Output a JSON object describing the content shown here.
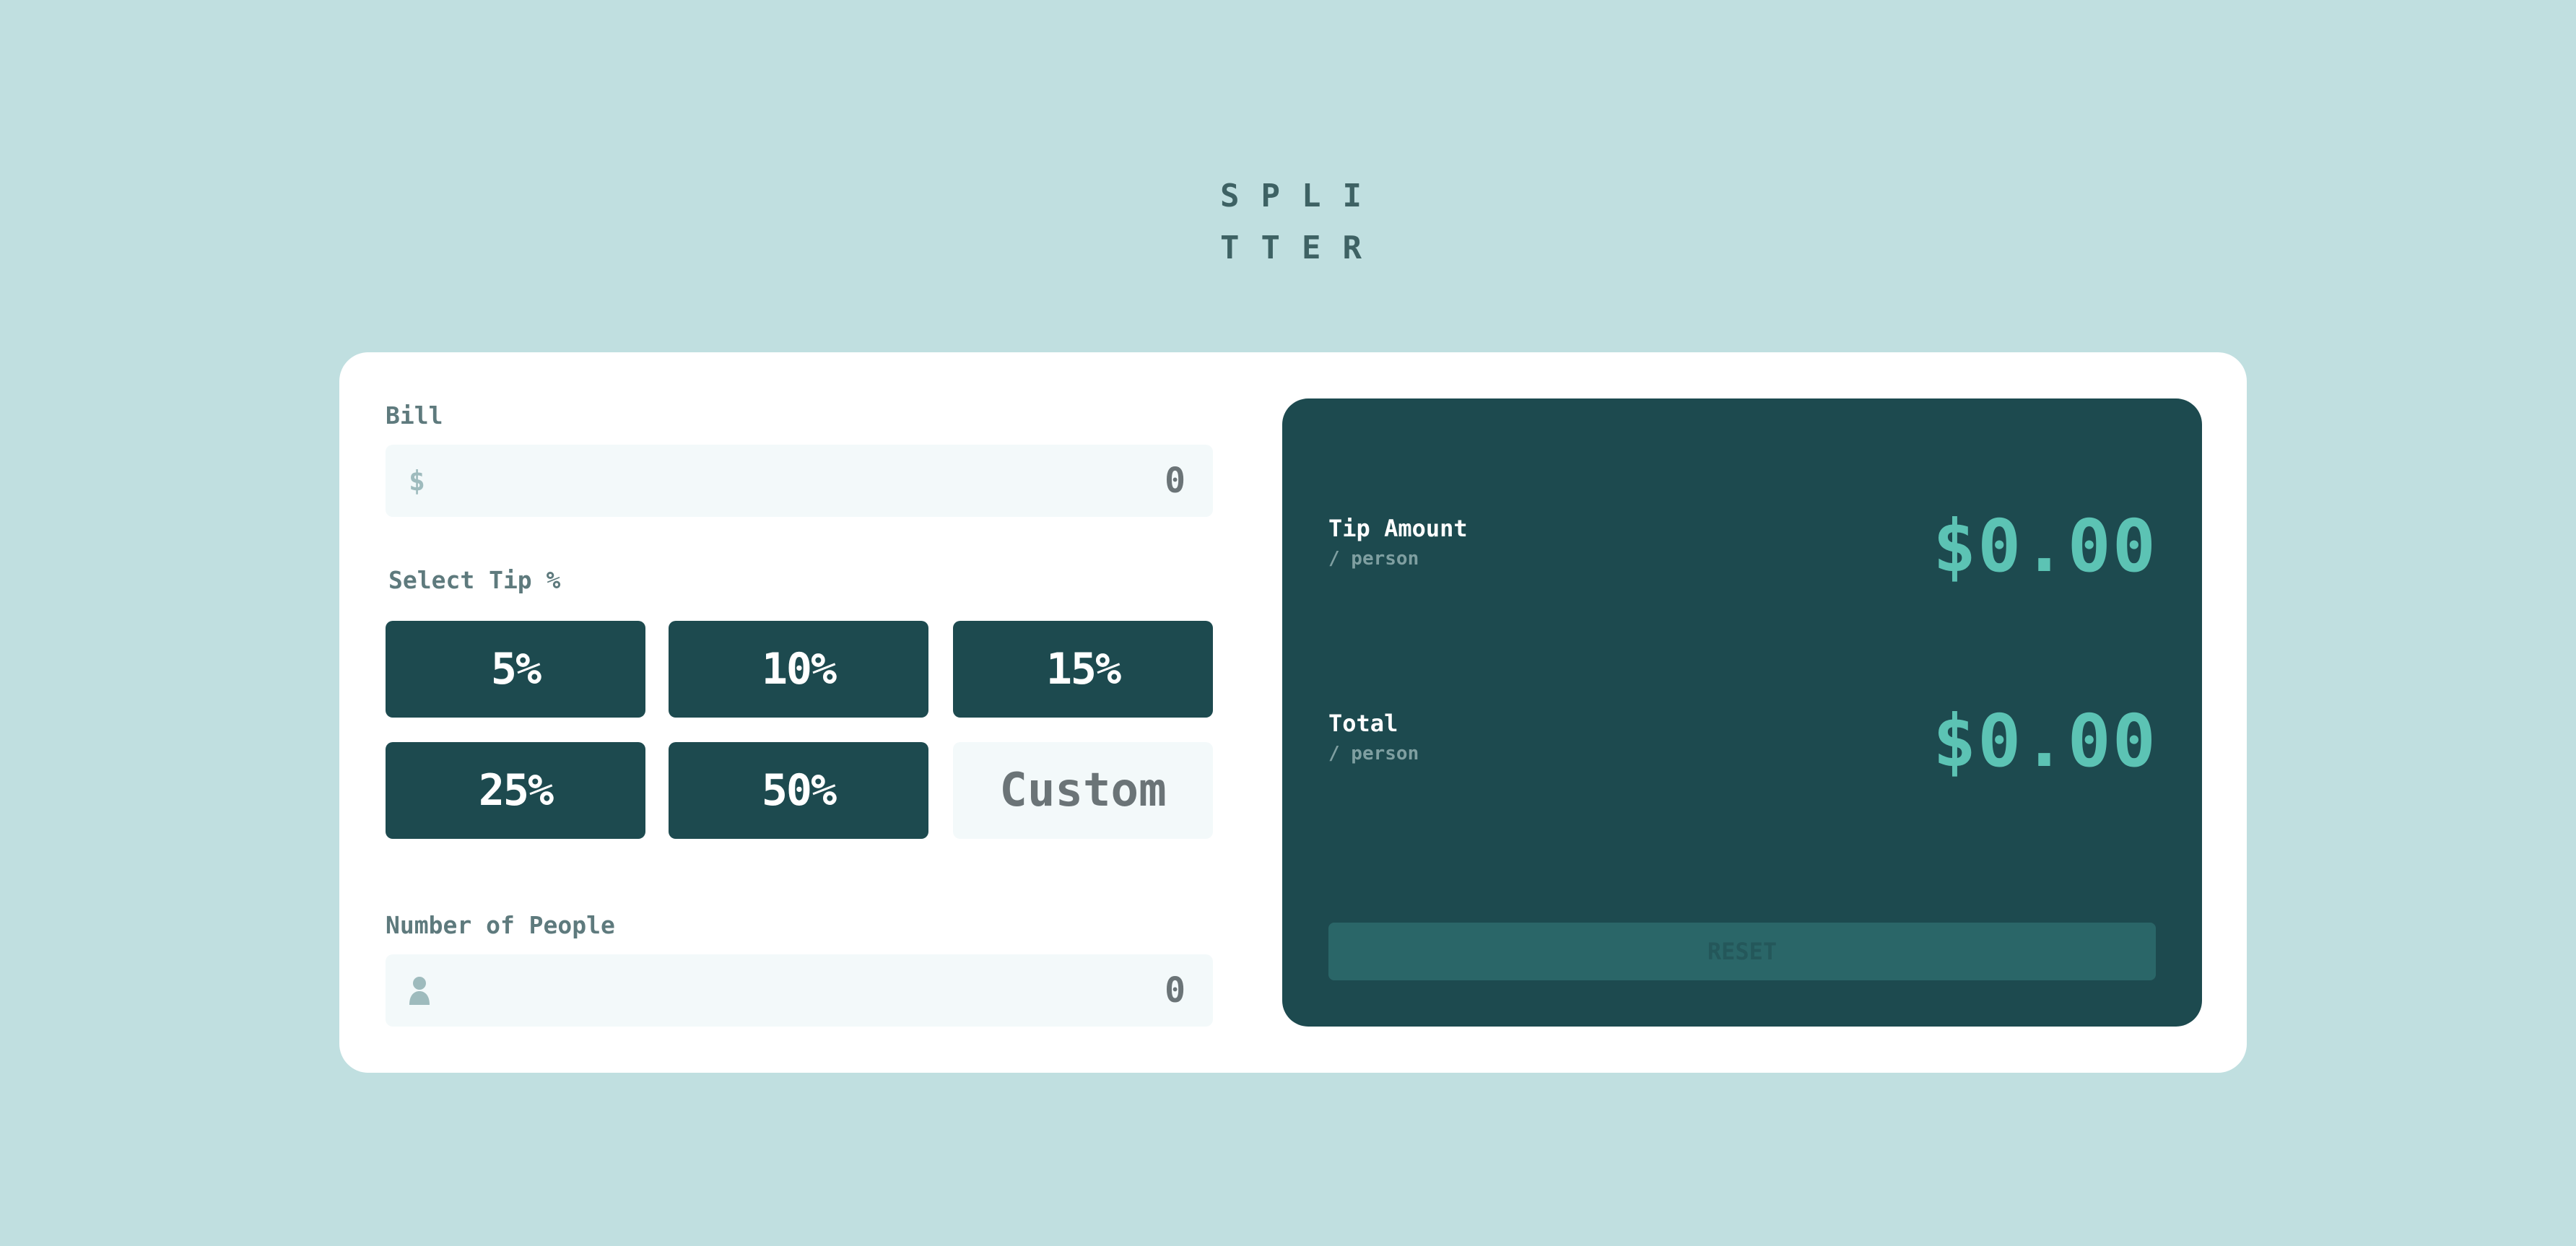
{
  "logo": {
    "line1": "SPLI",
    "line2": "TTER"
  },
  "bill": {
    "label": "Bill",
    "currency_icon": "dollar-icon",
    "value": "0"
  },
  "tip": {
    "label": "Select Tip %",
    "options": [
      "5%",
      "10%",
      "15%",
      "25%",
      "50%"
    ],
    "custom_placeholder": "Custom"
  },
  "people": {
    "label": "Number of People",
    "icon": "person-icon",
    "value": "0"
  },
  "results": {
    "tip_amount": {
      "label": "Tip Amount",
      "sub": "/ person",
      "value": "$0.00"
    },
    "total": {
      "label": "Total",
      "sub": "/ person",
      "value": "$0.00"
    },
    "reset_label": "RESET"
  },
  "colors": {
    "background": "#c0dfe0",
    "card": "#ffffff",
    "dark_teal": "#1d4a4f",
    "accent": "#5cc3b4",
    "input_bg": "#f3f9fa",
    "reset_bg": "#2a6668"
  }
}
